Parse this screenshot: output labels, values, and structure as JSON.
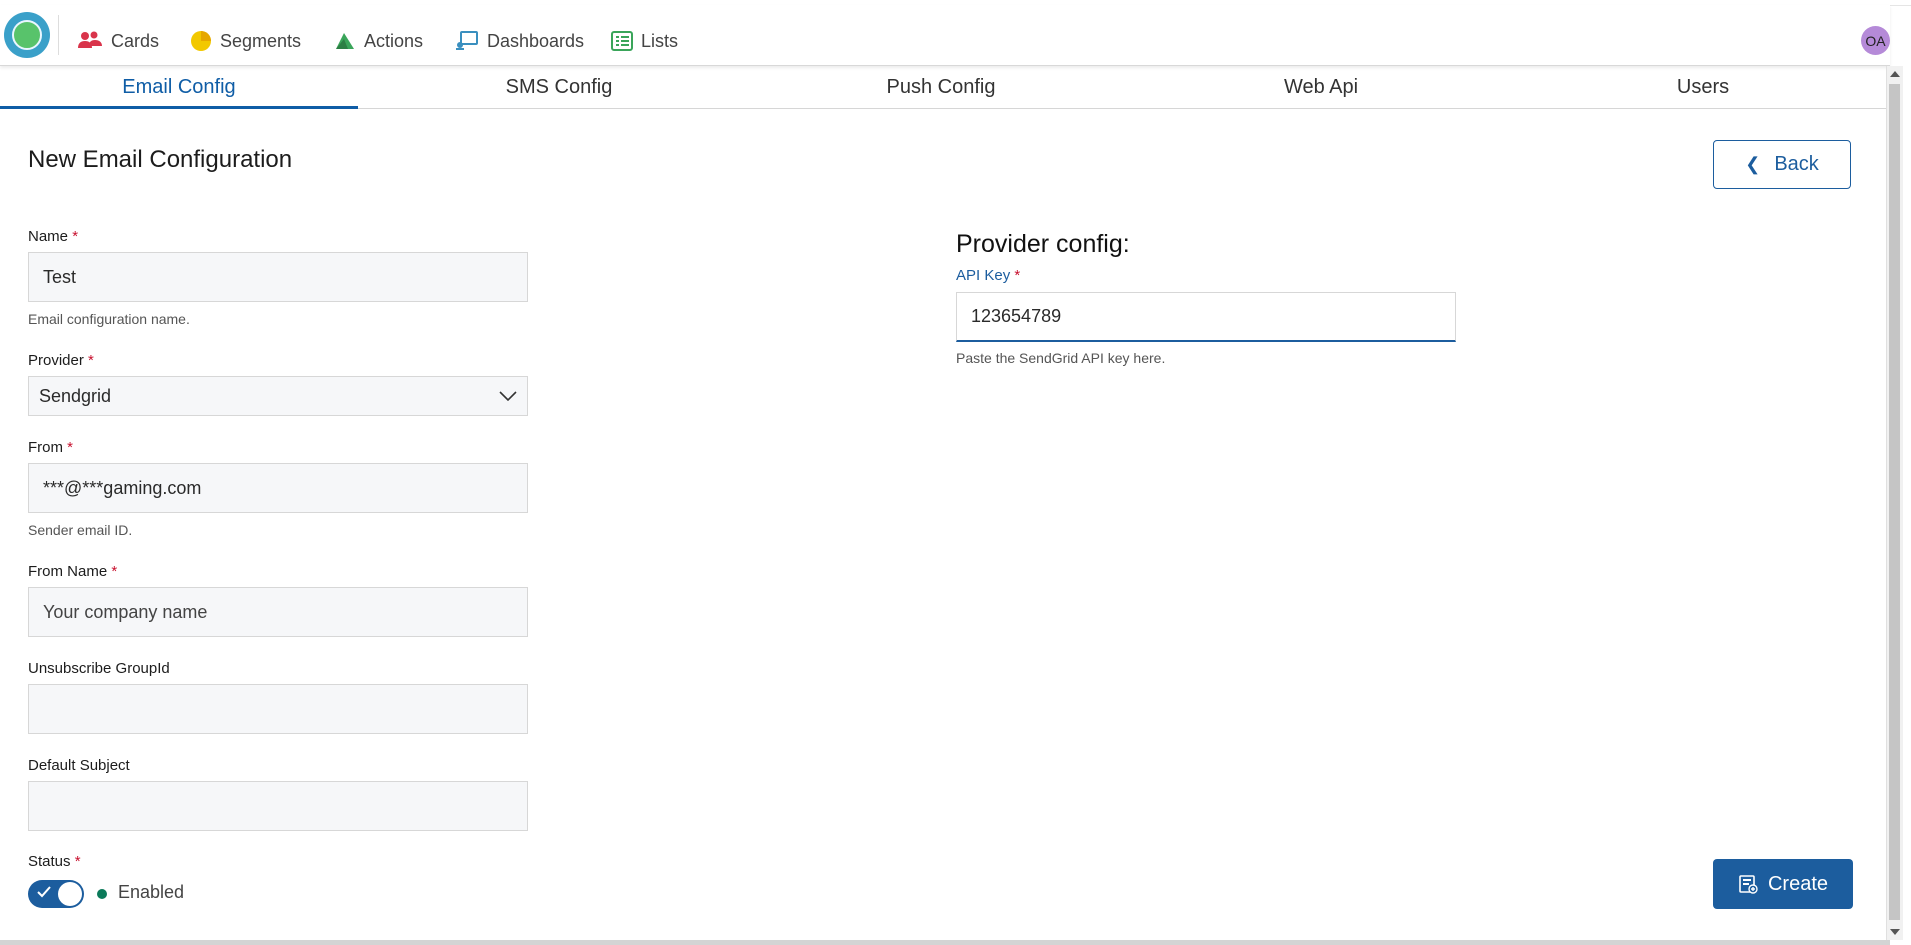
{
  "nav": {
    "items": [
      {
        "label": "Cards",
        "icon": "users-icon"
      },
      {
        "label": "Segments",
        "icon": "pie-chart-icon"
      },
      {
        "label": "Actions",
        "icon": "actions-icon"
      },
      {
        "label": "Dashboards",
        "icon": "dashboard-icon"
      },
      {
        "label": "Lists",
        "icon": "list-icon"
      }
    ],
    "avatar": "OA"
  },
  "tabs": [
    "Email Config",
    "SMS Config",
    "Push Config",
    "Web Api",
    "Users"
  ],
  "page": {
    "title": "New Email Configuration",
    "back_label": "Back"
  },
  "form": {
    "name": {
      "label": "Name",
      "required": "*",
      "value": "Test",
      "hint": "Email configuration name."
    },
    "provider": {
      "label": "Provider",
      "required": "*",
      "value": "Sendgrid"
    },
    "from": {
      "label": "From",
      "required": "*",
      "value": "***@***gaming.com",
      "hint": "Sender email ID."
    },
    "from_name": {
      "label": "From Name",
      "required": "*",
      "placeholder": "Your company name"
    },
    "unsubscribe": {
      "label": "Unsubscribe GroupId",
      "value": ""
    },
    "subject": {
      "label": "Default Subject",
      "value": ""
    },
    "status": {
      "label": "Status",
      "required": "*",
      "value": "Enabled"
    }
  },
  "provider_config": {
    "title": "Provider config:",
    "api_key_label": "API Key",
    "required": "*",
    "api_key_value": "123654789",
    "hint": "Paste the SendGrid API key here."
  },
  "actions": {
    "create_label": "Create"
  },
  "colors": {
    "primary": "#1c5d9e",
    "required": "#c8102e",
    "status": "#0b7a5a"
  }
}
